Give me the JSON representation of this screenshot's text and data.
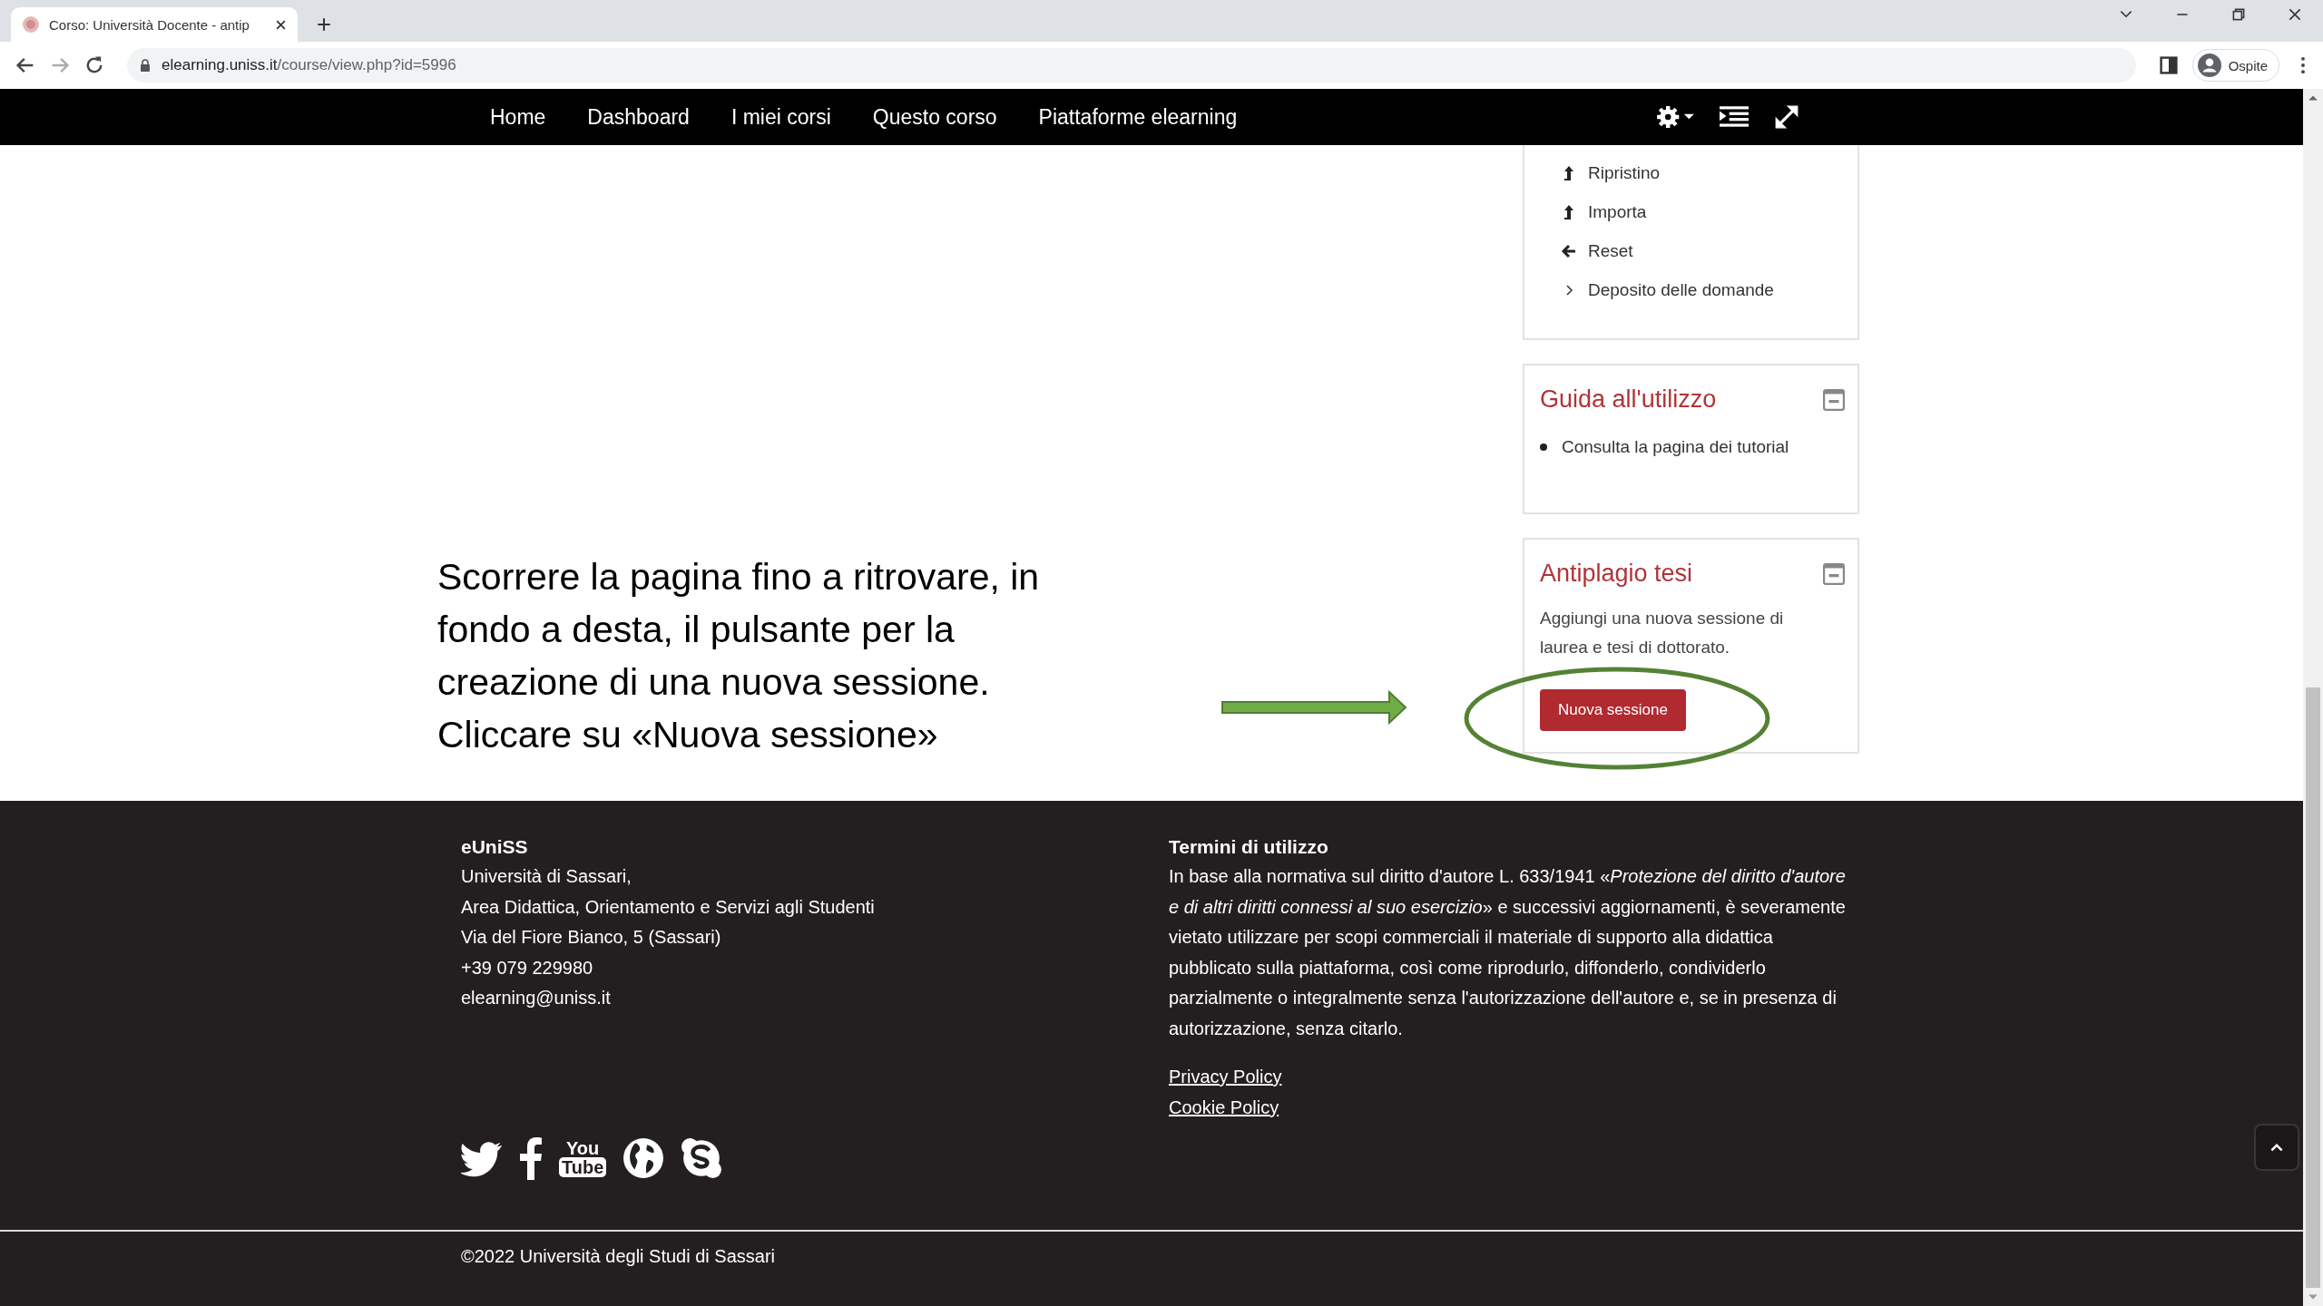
{
  "browser": {
    "tab_title": "Corso: Università Docente - antip",
    "url_host": "elearning.uniss.it",
    "url_path": "/course/view.php?id=5996",
    "profile": "Ospite"
  },
  "navbar": {
    "items": [
      {
        "label": "Home"
      },
      {
        "label": "Dashboard"
      },
      {
        "label": "I miei corsi"
      },
      {
        "label": "Questo corso"
      },
      {
        "label": "Piattaforme elearning"
      }
    ]
  },
  "admin_block": {
    "items": [
      {
        "label": "Ripristino",
        "kind": "upload"
      },
      {
        "label": "Importa",
        "kind": "upload"
      },
      {
        "label": "Reset",
        "kind": "back"
      },
      {
        "label": "Deposito delle domande",
        "kind": "chevron"
      }
    ]
  },
  "guide_block": {
    "title": "Guida all'utilizzo",
    "items": [
      "Consulta la pagina dei tutorial"
    ]
  },
  "antiplagio_block": {
    "title": "Antiplagio tesi",
    "text": "Aggiungi una nuova sessione di laurea e tesi di dottorato.",
    "button": "Nuova sessione"
  },
  "instruction": "Scorrere la pagina fino a ritrovare, in fondo a desta, il pulsante per la creazione di una nuova sessione. Cliccare su «Nuova sessione»",
  "footer": {
    "left": {
      "title": "eUniSS",
      "lines": [
        "Università di Sassari,",
        "Area Didattica, Orientamento e Servizi agli Studenti",
        "Via del Fiore Bianco, 5 (Sassari)",
        "+39 079 229980",
        "elearning@uniss.it"
      ]
    },
    "social": [
      {
        "kind": "twitter"
      },
      {
        "kind": "facebook"
      },
      {
        "kind": "youtube",
        "top": "You",
        "bottom": "Tube"
      },
      {
        "kind": "globe"
      },
      {
        "kind": "skype"
      }
    ],
    "right": {
      "title": "Termini di utilizzo",
      "text": "In base alla normativa sul diritto d'autore L. 633/1941 «*Protezione del diritto d'autore e di altri diritti connessi al suo esercizio*» e successivi aggiornamenti, è severamente vietato utilizzare per scopi commerciali il materiale di supporto alla didattica pubblicato sulla piattaforma, così come riprodurlo, diffonderlo, condividerlo parzialmente o integralmente senza l'autorizzazione dell'autore e, se in presenza di autorizzazione, senza citarlo.",
      "links": [
        "Privacy Policy",
        "Cookie Policy"
      ]
    },
    "copyright": "©2022 Università degli Studi di Sassari"
  }
}
